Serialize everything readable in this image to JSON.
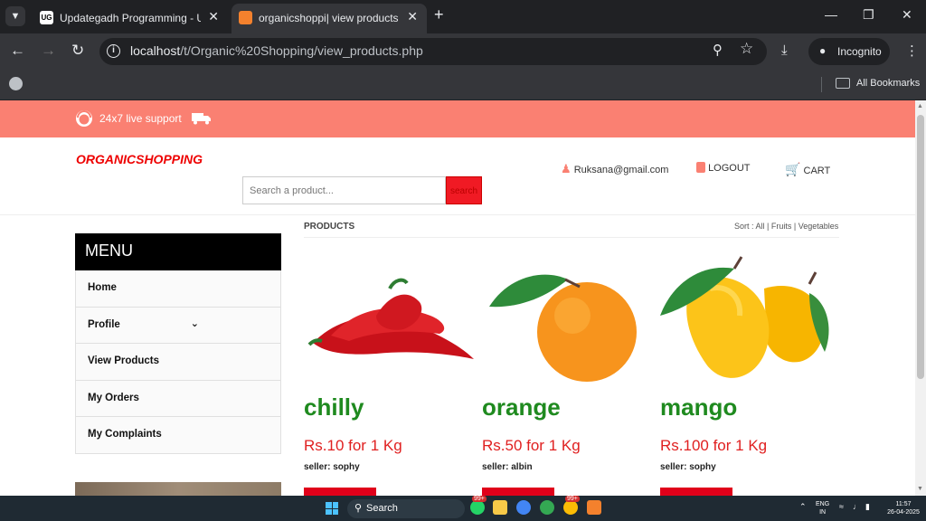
{
  "browser": {
    "tabs": [
      {
        "favicon": "UG",
        "title": "Updategadh Programming - Upda"
      },
      {
        "title": "organicshoppi| view products"
      }
    ],
    "url_host": "localhost",
    "url_path": "/t/Organic%20Shopping/view_products.php",
    "profile_label": "Incognito",
    "bookmarks_label": "All Bookmarks"
  },
  "site": {
    "support_text": "24x7 live support",
    "logo": "ORGANICSHOPPING",
    "search_placeholder": "Search a product...",
    "search_button": "search",
    "user_email": "Ruksana@gmail.com",
    "logout_label": "LOGOUT",
    "cart_label": "CART"
  },
  "menu": {
    "title": "MENU",
    "items": [
      "Home",
      "Profile",
      "View Products",
      "My Orders",
      "My Complaints"
    ]
  },
  "products": {
    "heading": "PRODUCTS",
    "sort_label": "Sort : All | Fruits | Vegetables",
    "items": [
      {
        "name": "chilly",
        "price": "Rs.10 for 1 Kg",
        "seller": "seller: sophy"
      },
      {
        "name": "orange",
        "price": "Rs.50 for 1 Kg",
        "seller": "seller: albin"
      },
      {
        "name": "mango",
        "price": "Rs.100 for 1 Kg",
        "seller": "seller: sophy"
      }
    ]
  },
  "taskbar": {
    "search_label": "Search",
    "lang_top": "ENG",
    "lang_bottom": "IN",
    "time": "11:57",
    "date": "26-04-2025",
    "badge_whatsapp": "99+",
    "badge_chrome": "99+"
  },
  "colors": {
    "topbar": "#fa8072",
    "logo": "#ee0000",
    "product_name": "#1f8a1f",
    "price": "#e02020",
    "button": "#e0001a"
  }
}
